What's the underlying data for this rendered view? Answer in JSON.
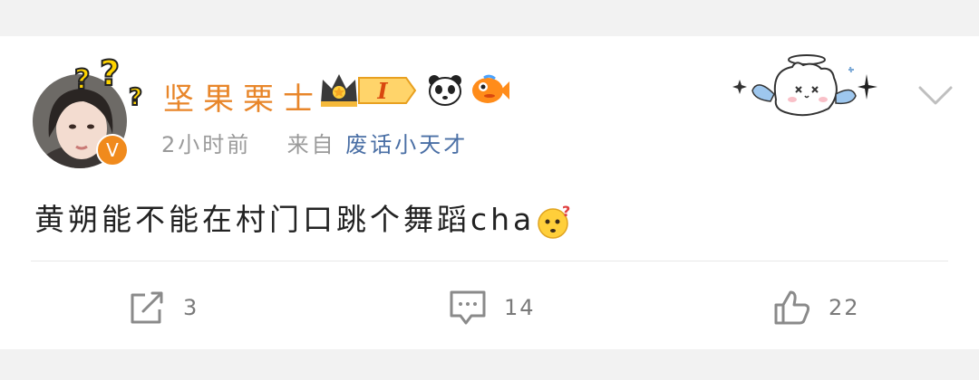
{
  "post": {
    "author": "坚果栗士",
    "level_badge": "I",
    "time": "2小时前",
    "from_label": "来自",
    "source": "废话小天才",
    "verified_badge": "V",
    "content_text": "黄朔能不能在村门口跳个舞蹈cha"
  },
  "actions": {
    "repost_count": "3",
    "comment_count": "14",
    "like_count": "22"
  },
  "colors": {
    "username": "#e8862a",
    "source_link": "#4a6fa5",
    "badge_orange": "#f08a1c",
    "icon_gray": "#8a8a8a"
  }
}
